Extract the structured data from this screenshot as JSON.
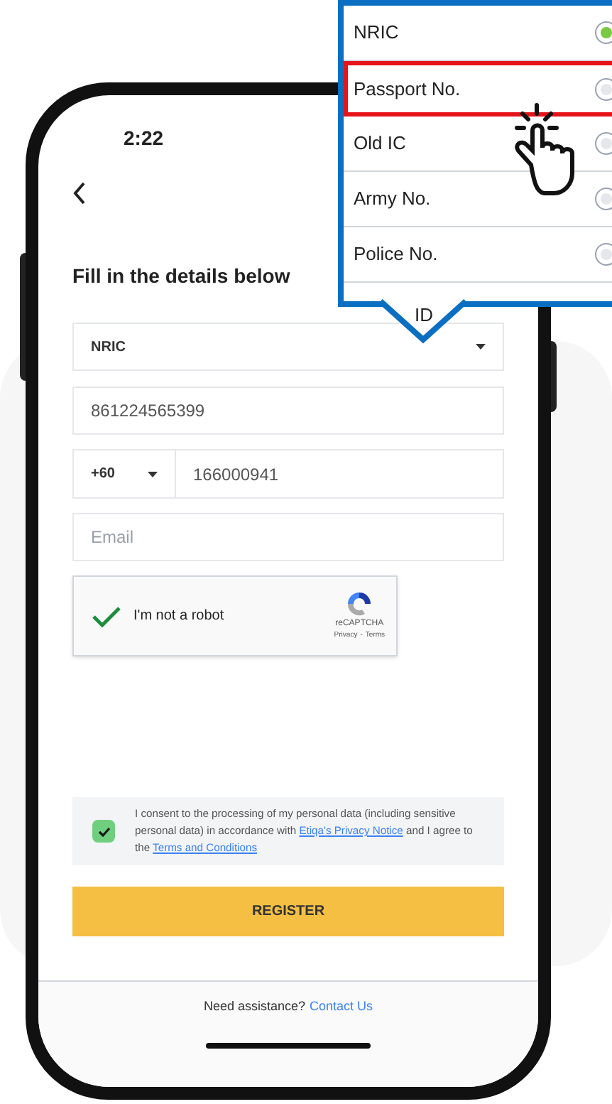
{
  "status_bar": {
    "time": "2:22"
  },
  "form": {
    "heading": "Fill in the details below",
    "id_type": {
      "value": "NRIC"
    },
    "id_number": {
      "value": "861224565399"
    },
    "phone": {
      "country_code": "+60",
      "number": "166000941"
    },
    "email": {
      "placeholder": "Email"
    },
    "captcha": {
      "label": "I'm not a robot",
      "checked": true,
      "brand": "reCAPTCHA",
      "privacy": "Privacy",
      "separator": "-",
      "terms": "Terms"
    },
    "consent": {
      "checked": true,
      "text_before": "I consent to the processing of my personal data (including sensitive personal data) in accordance with",
      "privacy_link": "Etiqa's Privacy Notice",
      "text_middle": "and I agree to the",
      "terms_link": "Terms and Conditions"
    },
    "register_button": "REGISTER",
    "footer": {
      "text": "Need assistance?",
      "link": "Contact Us"
    }
  },
  "callout": {
    "options": [
      {
        "label": "NRIC",
        "selected": true,
        "highlighted": false
      },
      {
        "label": "Passport No.",
        "selected": false,
        "highlighted": true
      },
      {
        "label": "Old IC",
        "selected": false,
        "highlighted": false
      },
      {
        "label": "Army No.",
        "selected": false,
        "highlighted": false
      },
      {
        "label": "Police No.",
        "selected": false,
        "highlighted": false
      }
    ],
    "cut_option": "ID"
  }
}
